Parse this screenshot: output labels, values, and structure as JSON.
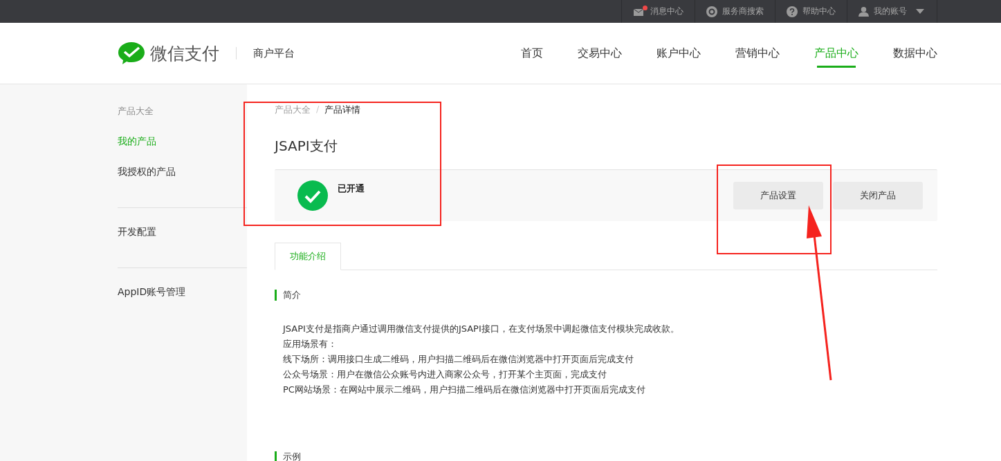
{
  "top_bar": {
    "links": [
      {
        "label": "消息中心",
        "unread": true,
        "dropdown": false
      },
      {
        "label": "服务商搜索",
        "unread": false,
        "dropdown": false
      },
      {
        "label": "帮助中心",
        "unread": false,
        "dropdown": false
      },
      {
        "label": "我的账号",
        "unread": false,
        "dropdown": true
      }
    ]
  },
  "header": {
    "logo_text": "微信支付",
    "platform": "商户平台",
    "nav": [
      {
        "label": "首页",
        "selected": false
      },
      {
        "label": "交易中心",
        "selected": false
      },
      {
        "label": "账户中心",
        "selected": false
      },
      {
        "label": "营销中心",
        "selected": false
      },
      {
        "label": "产品中心",
        "selected": true
      },
      {
        "label": "数据中心",
        "selected": false
      }
    ]
  },
  "sidebar": {
    "groups": [
      {
        "title": "产品大全",
        "items": [
          {
            "label": "我的产品",
            "selected": true
          },
          {
            "label": "我授权的产品",
            "selected": false
          }
        ]
      },
      {
        "items": [
          {
            "label": "开发配置",
            "selected": false
          }
        ]
      },
      {
        "items": [
          {
            "label": "AppID账号管理",
            "selected": false
          }
        ]
      }
    ]
  },
  "breadcrumb": [
    "产品大全",
    "产品详情"
  ],
  "breadcrumb_separator": "/",
  "title": "JSAPI支付",
  "status": {
    "label": "已开通",
    "enabled": true
  },
  "buttons": [
    "产品设置",
    "关闭产品"
  ],
  "tabs": [
    {
      "label": "功能介绍",
      "selected": true
    }
  ],
  "sections": [
    {
      "heading": "简介",
      "lines": [
        "JSAPI支付是指商户通过调用微信支付提供的JSAPI接口，在支付场景中调起微信支付模块完成收款。",
        "应用场景有：",
        "线下场所：调用接口生成二维码，用户扫描二维码后在微信浏览器中打开页面后完成支付",
        "公众号场景：用户在微信公众账号内进入商家公众号，打开某个主页面，完成支付",
        "PC网站场景：在网站中展示二维码，用户扫描二维码后在微信浏览器中打开页面后完成支付"
      ]
    },
    {
      "heading": "示例"
    }
  ]
}
